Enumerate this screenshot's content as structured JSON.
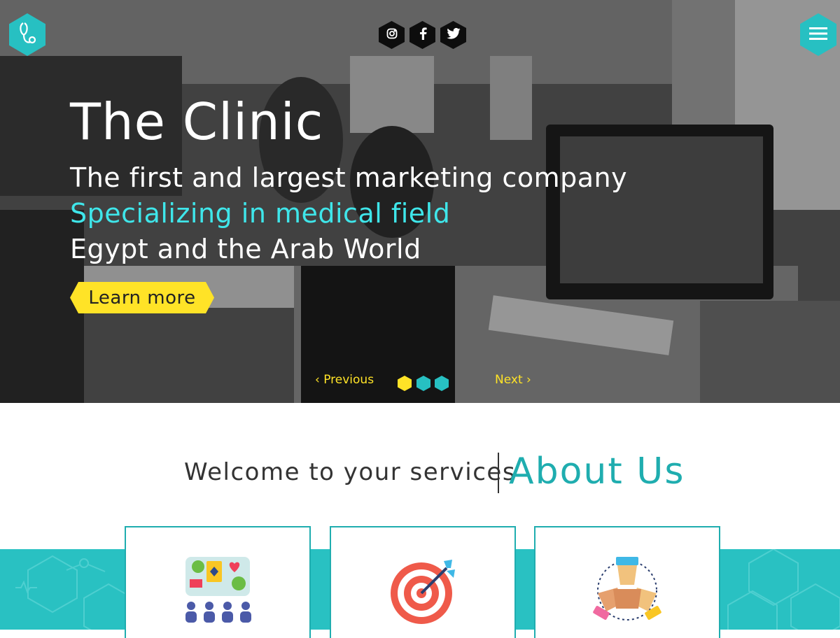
{
  "hero": {
    "title": "The Clinic",
    "line1": "The first and largest marketing company",
    "line2": "Specializing in medical field",
    "line3": "Egypt and the Arab World",
    "cta_label": "Learn more",
    "prev_label": "Previous",
    "next_label": "Next",
    "slides_total": 3,
    "active_slide": 1
  },
  "header": {
    "logo_icon": "stethoscope-icon",
    "menu_icon": "hamburger-menu-icon",
    "social": [
      "instagram-icon",
      "facebook-icon",
      "twitter-icon"
    ]
  },
  "about": {
    "welcome": "Welcome to your services",
    "title": "About Us"
  },
  "cards": [
    {
      "icon": "team-board-icon"
    },
    {
      "icon": "target-icon"
    },
    {
      "icon": "teamwork-hands-icon"
    }
  ],
  "colors": {
    "accent": "#27c0c2",
    "accent_dark": "#1fadaf",
    "highlight": "#ffe327",
    "cyan_text": "#3fe6ea"
  }
}
